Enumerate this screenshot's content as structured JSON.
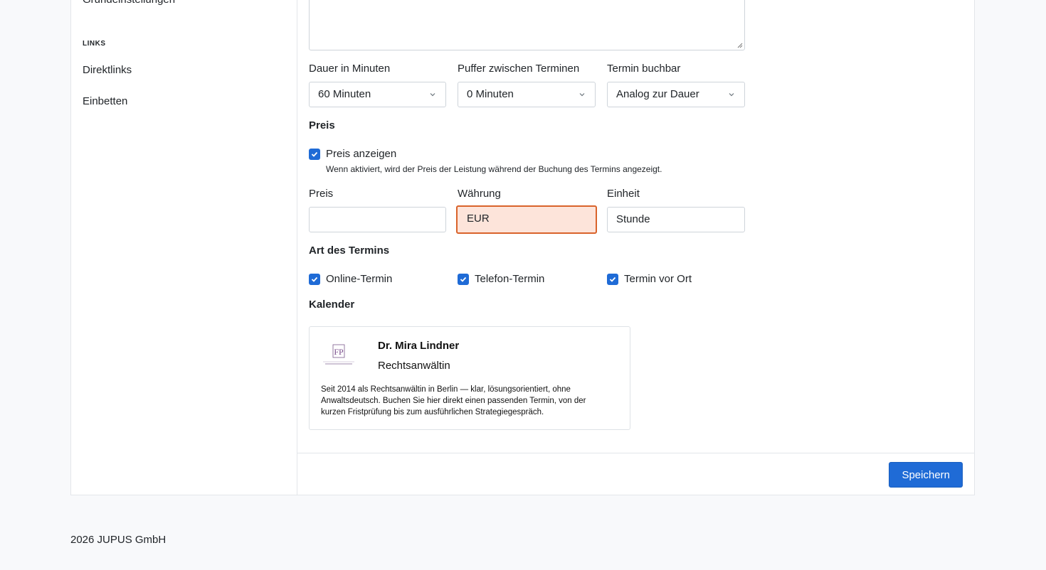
{
  "sidebar": {
    "partial_item": "Grundeinstellungen",
    "links_heading": "LINKS",
    "items": [
      {
        "label": "Direktlinks"
      },
      {
        "label": "Einbetten"
      }
    ]
  },
  "form": {
    "duration": {
      "label": "Dauer in Minuten",
      "value": "60 Minuten"
    },
    "buffer": {
      "label": "Puffer zwischen Terminen",
      "value": "0 Minuten"
    },
    "bookable": {
      "label": "Termin buchbar",
      "value": "Analog zur Dauer"
    },
    "price_section": "Preis",
    "show_price": {
      "label": "Preis anzeigen",
      "checked": true,
      "hint": "Wenn aktiviert, wird der Preis der Leistung während der Buchung des Termins angezeigt."
    },
    "price": {
      "label": "Preis",
      "value": ""
    },
    "currency": {
      "label": "Währung",
      "value": "EUR"
    },
    "unit": {
      "label": "Einheit",
      "value": "Stunde"
    },
    "type_section": "Art des Termins",
    "types": [
      {
        "label": "Online-Termin",
        "checked": true
      },
      {
        "label": "Telefon-Termin",
        "checked": true
      },
      {
        "label": "Termin vor Ort",
        "checked": true
      }
    ],
    "calendar_section": "Kalender",
    "profile": {
      "name": "Dr. Mira Lindner",
      "role": "Rechtsanwältin",
      "logo_text": "FP",
      "bio": "Seit 2014 als Rechtsanwältin in Berlin — klar, lösungsorientiert, ohne Anwaltsdeutsch. Buchen Sie hier direkt einen passenden Termin, von der kurzen Fristprüfung bis zum ausführlichen Strategiegespräch."
    },
    "save_label": "Speichern"
  },
  "footer": {
    "copyright": "2026 JUPUS GmbH"
  },
  "colors": {
    "accent": "#1f6bd6",
    "focus_border": "#d9632b",
    "focus_bg": "#fde4da"
  }
}
